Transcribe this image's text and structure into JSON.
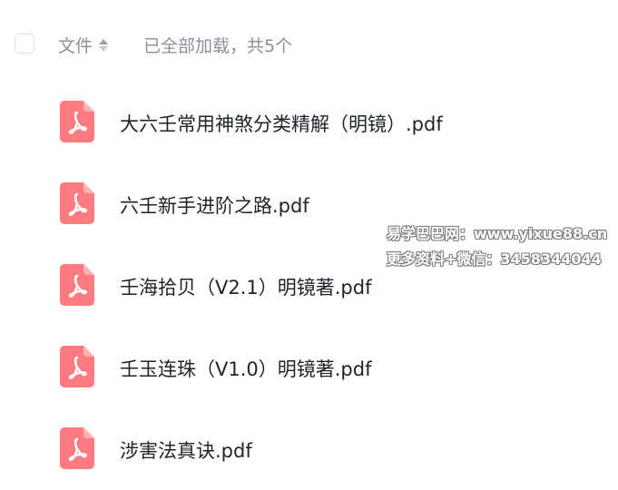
{
  "header": {
    "column_label": "文件",
    "status": "已全部加载，共5个"
  },
  "files": [
    {
      "name": "大六壬常用神煞分类精解（明镜）.pdf",
      "icon": "pdf-icon"
    },
    {
      "name": "六壬新手进阶之路.pdf",
      "icon": "pdf-icon"
    },
    {
      "name": "壬海拾贝（V2.1）明镜著.pdf",
      "icon": "pdf-icon"
    },
    {
      "name": "壬玉连珠（V1.0）明镜著.pdf",
      "icon": "pdf-icon"
    },
    {
      "name": "涉害法真诀.pdf",
      "icon": "pdf-icon"
    }
  ],
  "watermark": {
    "line1": "易学巴巴网：www.yixue88.cn",
    "line2": "更多资料+微信：3458344044"
  },
  "colors": {
    "pdf_icon": "#ff7b7f",
    "muted_text": "#8a8f99",
    "body_text": "#1f2329"
  }
}
